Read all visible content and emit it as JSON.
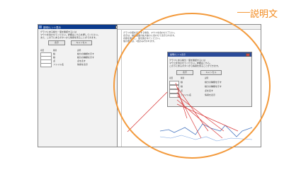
{
  "left_dialog": {
    "title": "説明/ヒント表示",
    "desc_lines": [
      "グラフにある線分・値を確認するには",
      "マウスを合わせてください。詳細はこちらを押してください。",
      "また、この下にあるボタンから情報を見ることができます。"
    ],
    "buttons": [
      "表示",
      "キャンセル"
    ],
    "table": {
      "headers": [
        "項目",
        "種別",
        "説明"
      ],
      "rows": [
        [
          "",
          "線",
          "線分の種類を示す"
        ],
        [
          "",
          "線",
          "線分の種類を示す"
        ],
        [
          "",
          "点",
          "点を表す"
        ],
        [
          "",
          "ファイル名",
          "情報を表示"
        ]
      ]
    }
  },
  "main_window": {
    "text_lines": [
      "グラフの値を表示する場合、マウスを合わせて下さい。",
      "表示は、描画画面の拡大縮小に合わせて表示されます。",
      "内容を確認し、値を確かめてください。",
      "値の更新は、1回のみ行われます。"
    ],
    "inner_dialog": {
      "title": "説明/ヒント表示",
      "desc_lines": [
        "グラフにある線分・値を確認するには",
        "マウスを合わせてください。詳細はこちら。",
        "この下にあるボタンから情報を見ることができます。"
      ],
      "buttons": [
        "表示",
        "キャンセル"
      ],
      "headers": [
        "項目",
        "種別",
        "説明"
      ],
      "rows": [
        [
          "",
          "線",
          "線分の種類を示す"
        ],
        [
          "",
          "線",
          "線分の種類を示す"
        ],
        [
          "",
          "点",
          "点を表す"
        ],
        [
          "",
          "ファイル名",
          "情報を表示"
        ]
      ]
    }
  },
  "callout": {
    "label": "説明文",
    "color": "#f28a1e"
  },
  "colors": {
    "title_bar": "#0b3a8c",
    "ring": "#f39a3c",
    "annotation": "#d93a3a"
  }
}
